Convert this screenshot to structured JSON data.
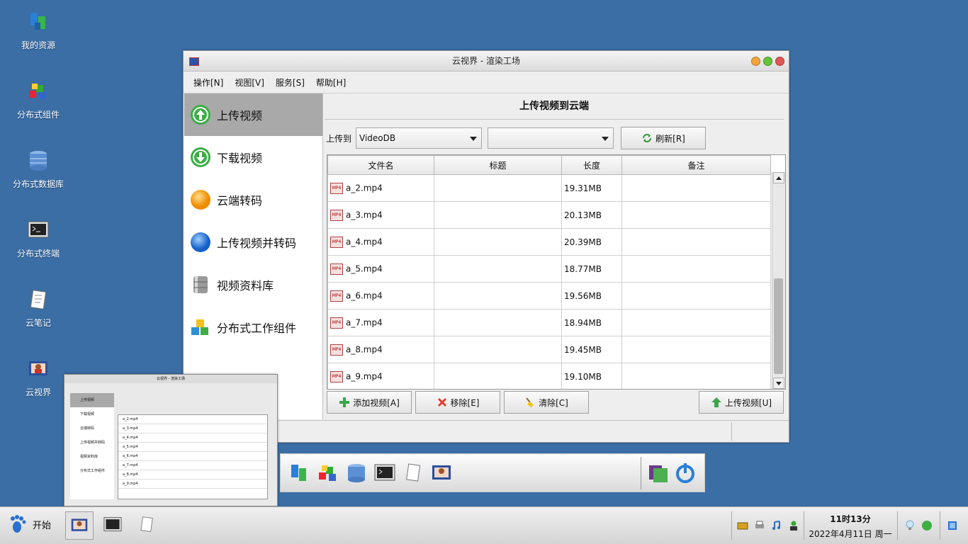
{
  "desktop": {
    "icons": [
      {
        "label": "我的资源"
      },
      {
        "label": "分布式组件"
      },
      {
        "label": "分布式数据库"
      },
      {
        "label": "分布式终端"
      },
      {
        "label": "云笔记"
      },
      {
        "label": "云视界"
      }
    ]
  },
  "window": {
    "title": "云视界 - 渲染工场",
    "menu": [
      "操作[N]",
      "视图[V]",
      "服务[S]",
      "帮助[H]"
    ],
    "nav": [
      {
        "label": "上传视频",
        "active": true,
        "icon": "upload-icon"
      },
      {
        "label": "下载视频",
        "active": false,
        "icon": "download-icon"
      },
      {
        "label": "云端转码",
        "active": false,
        "icon": "orange-ball-icon"
      },
      {
        "label": "上传视频并转码",
        "active": false,
        "icon": "blue-ball-icon"
      },
      {
        "label": "视频资料库",
        "active": false,
        "icon": "database-icon"
      },
      {
        "label": "分布式工作组件",
        "active": false,
        "icon": "cubes-icon"
      }
    ],
    "content": {
      "title": "上传视频到云端",
      "upload_to_label": "上传到",
      "target_select": "VideoDB",
      "secondary_select": "",
      "refresh_label": "刷新[R]",
      "columns": [
        "文件名",
        "标题",
        "长度",
        "备注"
      ],
      "rows": [
        {
          "name": "a_2.mp4",
          "title": "",
          "size": "19.31MB",
          "note": ""
        },
        {
          "name": "a_3.mp4",
          "title": "",
          "size": "20.13MB",
          "note": ""
        },
        {
          "name": "a_4.mp4",
          "title": "",
          "size": "20.39MB",
          "note": ""
        },
        {
          "name": "a_5.mp4",
          "title": "",
          "size": "18.77MB",
          "note": ""
        },
        {
          "name": "a_6.mp4",
          "title": "",
          "size": "19.56MB",
          "note": ""
        },
        {
          "name": "a_7.mp4",
          "title": "",
          "size": "18.94MB",
          "note": ""
        },
        {
          "name": "a_8.mp4",
          "title": "",
          "size": "19.45MB",
          "note": ""
        },
        {
          "name": "a_9.mp4",
          "title": "",
          "size": "19.10MB",
          "note": ""
        }
      ],
      "file_badge": "MP4",
      "add_label": "添加视频[A]",
      "remove_label": "移除[E]",
      "clear_label": "清除[C]",
      "upload_label": "上传视频[U]"
    }
  },
  "taskbar": {
    "start_label": "开始",
    "time": "11时13分",
    "date": "2022年4月11日 周一"
  },
  "colors": {
    "desktop": "#3a6ea5",
    "active_nav": "#a9a9a9"
  }
}
